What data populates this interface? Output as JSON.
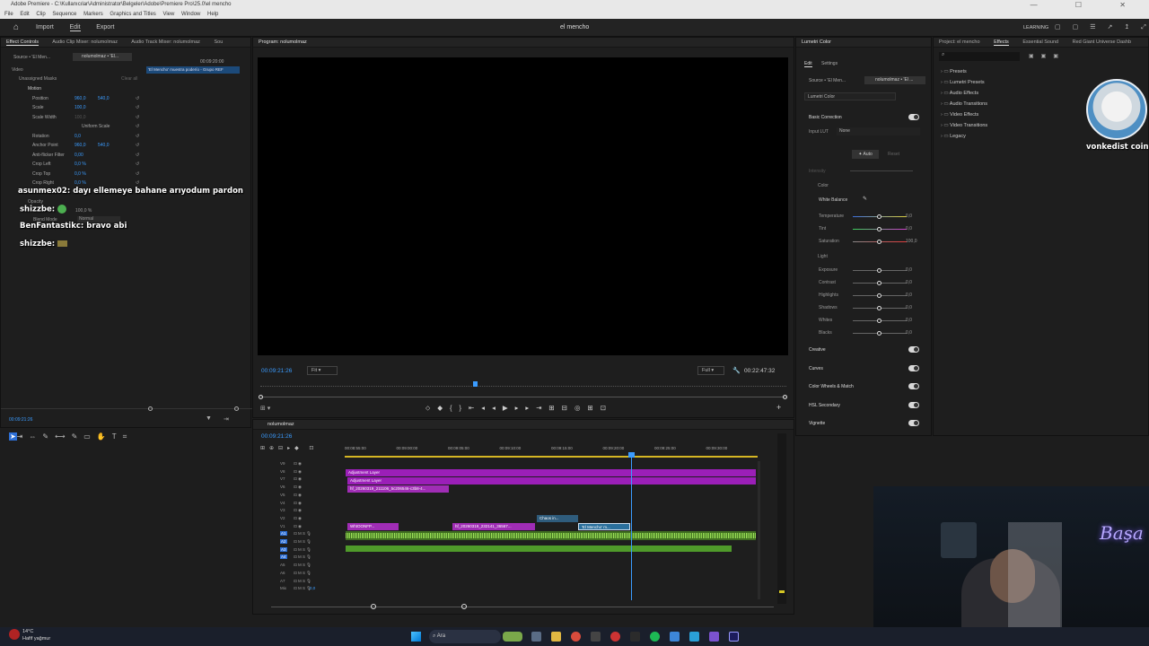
{
  "app": {
    "titlebar": "Adobe Premiere - C:\\Kullanıcılar\\Administrator\\Belgeler\\Adobe\\Premiere Pro\\25.0\\el mencho",
    "menu": [
      "File",
      "Edit",
      "Clip",
      "Sequence",
      "Markers",
      "Graphics and Titles",
      "View",
      "Window",
      "Help"
    ],
    "nav": [
      "Import",
      "Edit",
      "Export"
    ],
    "project_title": "el mencho",
    "learning": "LEARNING"
  },
  "effect_controls": {
    "tabs": [
      "Effect Controls",
      "Audio Clip Mixer: nolumolmaz",
      "Audio Track Mixer: nolumolmaz",
      "Sou"
    ],
    "source_tab": "Source • 'El Men...",
    "seq_tab": "nolumolmaz • 'El...",
    "timecode_header": "00:09:20:00",
    "clip_label": "'El Mencho' muestra poderío - Grupo REF",
    "section_video": "Video",
    "unassigned_masks": "Unassigned Masks",
    "clear_all": "Clear all",
    "motion": "Motion",
    "props": [
      {
        "name": "Position",
        "v1": "960,0",
        "v2": "540,0"
      },
      {
        "name": "Scale",
        "v1": "100,0",
        "v2": ""
      },
      {
        "name": "Scale Width",
        "v1": "100,0",
        "v2": ""
      },
      {
        "name": "Uniform Scale",
        "v1": "",
        "v2": ""
      },
      {
        "name": "Rotation",
        "v1": "0,0",
        "v2": ""
      },
      {
        "name": "Anchor Point",
        "v1": "960,0",
        "v2": "540,0"
      },
      {
        "name": "Anti-flicker Filter",
        "v1": "0,00",
        "v2": ""
      },
      {
        "name": "Crop Left",
        "v1": "0,0 %",
        "v2": ""
      },
      {
        "name": "Crop Top",
        "v1": "0,0 %",
        "v2": ""
      },
      {
        "name": "Crop Right",
        "v1": "0,0 %",
        "v2": ""
      }
    ],
    "opacity": "Opacity",
    "opacity_val": "100,0 %",
    "blend_mode": "Blend Mode",
    "blend_val": "Normal",
    "bottom_timecode": "00:09:21:26"
  },
  "chat": [
    {
      "user": "asunmex02:",
      "msg": "dayı ellemeye bahane arıyodum pardon"
    },
    {
      "user": "shizzbe:",
      "msg": ""
    },
    {
      "user": "BenFantastikc:",
      "msg": "bravo abi"
    },
    {
      "user": "shizzbe:",
      "msg": ""
    }
  ],
  "program": {
    "tab": "Program: nolumolmaz",
    "timecode": "00:09:21:26",
    "fit": "Fit",
    "full": "Full",
    "duration": "00:22:47:32"
  },
  "timeline": {
    "tab": "nolumolmaz",
    "timecode": "00:09:21:26",
    "ruler": [
      "00:08:55:00",
      "00:09:00:00",
      "00:09:05:00",
      "00:09:10:00",
      "00:09:15:00",
      "00:09:20:00",
      "00:09:25:00",
      "00:09:30:00"
    ],
    "tracks_v": [
      "V9",
      "V8",
      "V7",
      "V6",
      "V5",
      "V4",
      "V3",
      "V2",
      "V1"
    ],
    "tracks_a": [
      "A1",
      "A2",
      "A3",
      "A4",
      "A5",
      "A6",
      "A7",
      "Mix"
    ],
    "mix_val": "0,0",
    "clips": {
      "adj1": "Adjustment Layer",
      "adj2": "Adjustment Layer",
      "v6": "hf_20260319_211106_5c206546-c3b8-4...",
      "v1a": "WhtOONFP...",
      "v1b": "hf_20260319_232141_36567...",
      "v2": "Chaos in...",
      "v1c": "'El Mencho' m..."
    }
  },
  "lumetri": {
    "tab": "Lumetri Color",
    "sub_tabs": [
      "Edit",
      "Settings"
    ],
    "source": "Source • 'El Men...",
    "seq": "nolumolmaz • 'El ...",
    "effect": "Lumetri Color",
    "basic": "Basic Correction",
    "input_lut": "Input LUT",
    "lut_val": "None",
    "auto": "Auto",
    "reset": "Reset",
    "intensity": "Intensity",
    "color": "Color",
    "white_balance": "White Balance",
    "color_sliders": [
      {
        "name": "Temperature",
        "val": "0,0"
      },
      {
        "name": "Tint",
        "val": "0,0"
      },
      {
        "name": "Saturation",
        "val": "100,0"
      }
    ],
    "light": "Light",
    "light_sliders": [
      {
        "name": "Exposure",
        "val": "0,0"
      },
      {
        "name": "Contrast",
        "val": "0,0"
      },
      {
        "name": "Highlights",
        "val": "0,0"
      },
      {
        "name": "Shadows",
        "val": "0,0"
      },
      {
        "name": "Whites",
        "val": "0,0"
      },
      {
        "name": "Blacks",
        "val": "0,0"
      }
    ],
    "sections": [
      "Creative",
      "Curves",
      "Color Wheels & Match",
      "HSL Secondary",
      "Vignette"
    ]
  },
  "effects": {
    "tabs": [
      "Project: el mencho",
      "Effects",
      "Essential Sound",
      "Red Giant Universe Dashb"
    ],
    "items": [
      "Presets",
      "Lumetri Presets",
      "Audio Effects",
      "Audio Transitions",
      "Video Effects",
      "Video Transitions",
      "Legacy"
    ]
  },
  "overlay": {
    "cat_caption": "vonkedist coin",
    "neon": "Başa"
  },
  "taskbar": {
    "weather_temp": "14°C",
    "weather_desc": "Hafif yağmur",
    "search": "Ara"
  },
  "colors": {
    "accent": "#3b9cff",
    "adjustment": "#9b1fb8",
    "audio": "#5fae2e",
    "clip_pink": "#a02db5"
  }
}
